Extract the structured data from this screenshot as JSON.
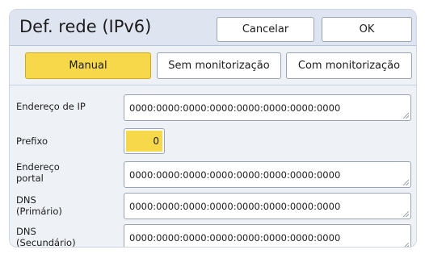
{
  "dialog": {
    "title": "Def. rede (IPv6)",
    "cancel_label": "Cancelar",
    "ok_label": "OK"
  },
  "mode_tabs": {
    "manual": "Manual",
    "without_monitoring": "Sem monitorização",
    "with_monitoring": "Com monitorização",
    "selected": "Manual"
  },
  "fields": {
    "ip_address": {
      "label": "Endereço de IP",
      "value": "0000:0000:0000:0000:0000:0000:0000:0000"
    },
    "prefix": {
      "label": "Prefixo",
      "value": "0"
    },
    "gateway": {
      "label_line1": "Endereço",
      "label_line2": "portal",
      "value": "0000:0000:0000:0000:0000:0000:0000:0000"
    },
    "dns_primary": {
      "label_line1": "DNS",
      "label_line2": "(Primário)",
      "value": "0000:0000:0000:0000:0000:0000:0000:0000"
    },
    "dns_secondary": {
      "label_line1": "DNS",
      "label_line2": "(Secundário)",
      "value": "0000:0000:0000:0000:0000:0000:0000:0000"
    }
  },
  "colors": {
    "accent_selected": "#f6d84a",
    "header_bg": "#dfe5f0",
    "panel_bg": "#eef1f6"
  }
}
